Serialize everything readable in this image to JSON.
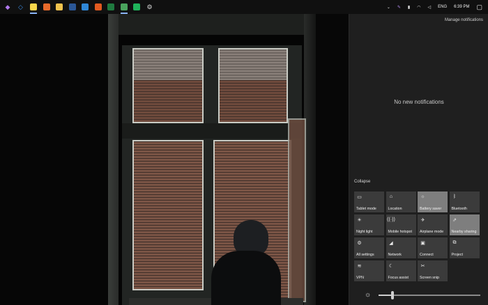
{
  "taskbar": {
    "apps": [
      {
        "name": "visual-studio-icon",
        "color": "#b179f1",
        "glyph": "◆"
      },
      {
        "name": "vs-code-icon",
        "color": "#3c8ee6",
        "glyph": "◇"
      },
      {
        "name": "sticky-notes-icon",
        "color": "#f7d54a",
        "glyph": ""
      },
      {
        "name": "chrome-canary-icon",
        "color": "#e86a2b",
        "glyph": ""
      },
      {
        "name": "file-explorer-icon",
        "color": "#f0c24d",
        "glyph": ""
      },
      {
        "name": "word-icon",
        "color": "#2b5797",
        "glyph": ""
      },
      {
        "name": "edge-icon",
        "color": "#2f86d6",
        "glyph": ""
      },
      {
        "name": "firefox-icon",
        "color": "#e25a20",
        "glyph": ""
      },
      {
        "name": "excel-icon",
        "color": "#1f7a3f",
        "glyph": ""
      },
      {
        "name": "chrome-icon",
        "color": "#4aa35d",
        "glyph": ""
      },
      {
        "name": "green-app-icon",
        "color": "#1fb25a",
        "glyph": ""
      },
      {
        "name": "settings-icon",
        "color": "#d8d8d8",
        "glyph": "⚙"
      }
    ],
    "tray": {
      "lang": "ENG",
      "time": "6:39 PM"
    }
  },
  "action_center": {
    "manage_label": "Manage notifications",
    "empty_label": "No new notifications",
    "collapse_label": "Collapse",
    "tiles": [
      {
        "label": "Tablet mode",
        "icon": "tablet-mode-icon",
        "glyph": "▭",
        "on": false
      },
      {
        "label": "Location",
        "icon": "location-icon",
        "glyph": "⌂",
        "on": false
      },
      {
        "label": "Battery saver",
        "icon": "battery-saver-icon",
        "glyph": "☼",
        "on": true
      },
      {
        "label": "Bluetooth",
        "icon": "bluetooth-icon",
        "glyph": "ᛒ",
        "on": false
      },
      {
        "label": "Night light",
        "icon": "night-light-icon",
        "glyph": "☀",
        "on": false
      },
      {
        "label": "Mobile hotspot",
        "icon": "mobile-hotspot-icon",
        "glyph": "((·))",
        "on": false
      },
      {
        "label": "Airplane mode",
        "icon": "airplane-mode-icon",
        "glyph": "✈",
        "on": false
      },
      {
        "label": "Nearby sharing",
        "icon": "nearby-sharing-icon",
        "glyph": "⇗",
        "on": true
      },
      {
        "label": "All settings",
        "icon": "all-settings-icon",
        "glyph": "⚙",
        "on": false
      },
      {
        "label": "Network",
        "icon": "network-icon",
        "glyph": "◢",
        "on": false
      },
      {
        "label": "Connect",
        "icon": "connect-icon",
        "glyph": "▣",
        "on": false
      },
      {
        "label": "Project",
        "icon": "project-icon",
        "glyph": "⧉",
        "on": false
      },
      {
        "label": "VPN",
        "icon": "vpn-icon",
        "glyph": "≋",
        "on": false
      },
      {
        "label": "Focus assist",
        "icon": "focus-assist-icon",
        "glyph": "☾",
        "on": false
      },
      {
        "label": "Screen snip",
        "icon": "screen-snip-icon",
        "glyph": "✂",
        "on": false
      }
    ],
    "brightness": 0.14
  }
}
